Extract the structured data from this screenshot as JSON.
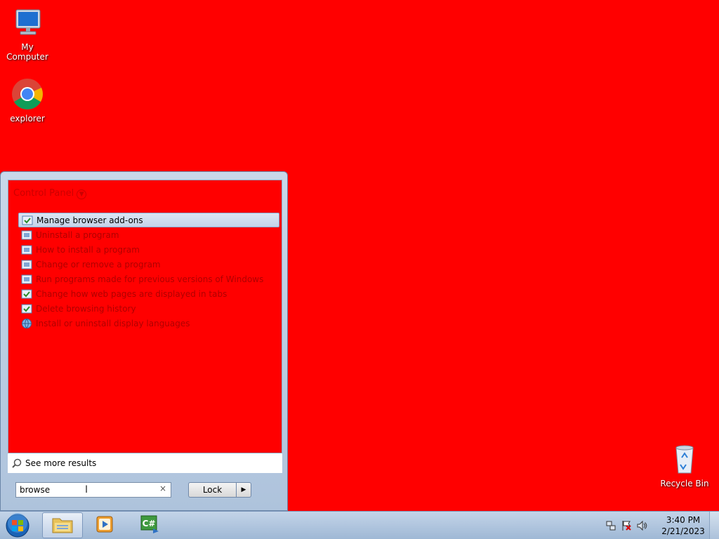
{
  "desktop": {
    "icons": [
      {
        "label": "My Computer",
        "icon": "computer-icon"
      },
      {
        "label": "explorer",
        "icon": "chrome-icon"
      },
      {
        "label": "Recycle Bin",
        "icon": "recycle-bin-icon"
      }
    ],
    "background_color": "#ff0000"
  },
  "start_menu": {
    "group_header": "Control Panel",
    "results": [
      {
        "label": "Manage browser add-ons",
        "icon": "control-panel-icon",
        "selected": true
      },
      {
        "label": "Uninstall a program",
        "icon": "control-panel-icon",
        "selected": false
      },
      {
        "label": "How to install a program",
        "icon": "control-panel-icon",
        "selected": false
      },
      {
        "label": "Change or remove a program",
        "icon": "control-panel-icon",
        "selected": false
      },
      {
        "label": "Run programs made for previous versions of Windows",
        "icon": "control-panel-icon",
        "selected": false
      },
      {
        "label": "Change how web pages are displayed in tabs",
        "icon": "control-panel-icon",
        "selected": false
      },
      {
        "label": "Delete browsing history",
        "icon": "control-panel-icon",
        "selected": false
      },
      {
        "label": "Install or uninstall display languages",
        "icon": "globe-icon",
        "selected": false
      }
    ],
    "see_more": "See more results",
    "search": {
      "value": "browse",
      "clear_glyph": "×"
    },
    "lock_button": "Lock",
    "lock_arrow": "▶"
  },
  "taskbar": {
    "buttons": [
      {
        "name": "windows-explorer",
        "icon": "folder-icon",
        "active": true
      },
      {
        "name": "media-player",
        "icon": "media-player-icon",
        "active": false
      },
      {
        "name": "csharp-editor",
        "icon": "csharp-icon",
        "active": false
      }
    ],
    "tray": [
      "network-icon",
      "action-center-flag-icon",
      "volume-icon"
    ],
    "clock": {
      "time": "3:40 PM",
      "date": "2/21/2023"
    }
  }
}
